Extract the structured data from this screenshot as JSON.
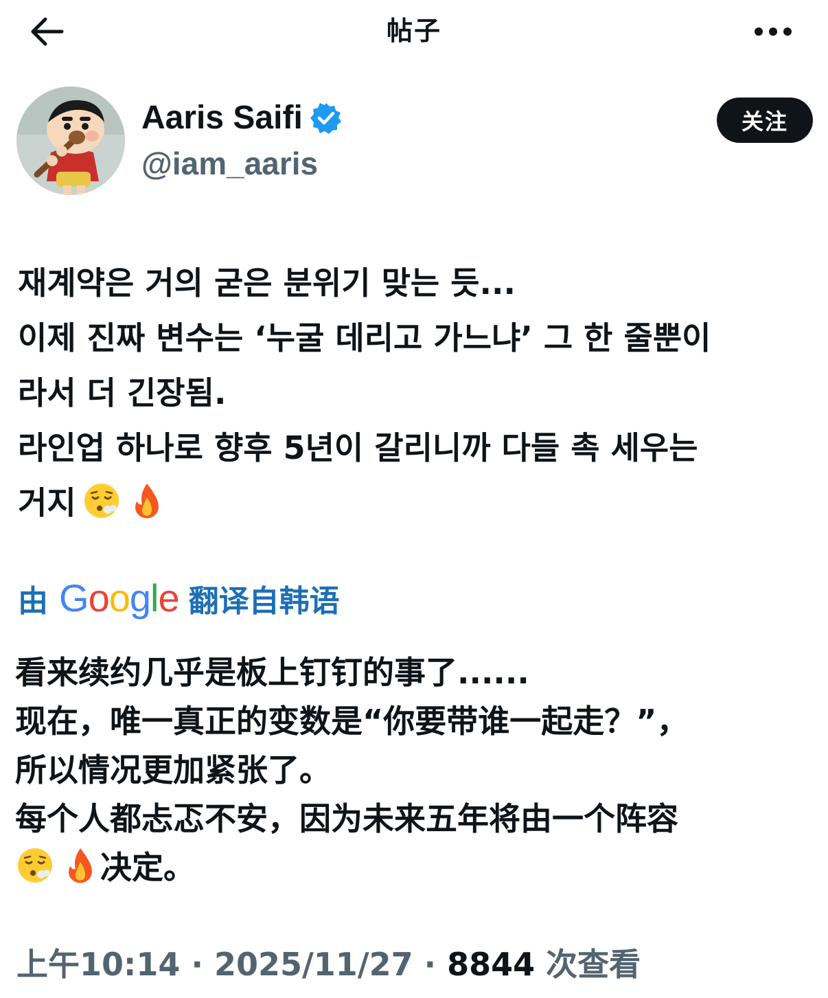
{
  "header": {
    "title": "帖子",
    "back_icon": "arrow-left-icon",
    "more_icon": "more-horizontal-icon"
  },
  "author": {
    "display_name": "Aaris Saifi",
    "handle": "@iam_aaris",
    "verified": true,
    "verified_color": "#1d9bf0",
    "follow_label": "关注"
  },
  "post": {
    "original_lines": [
      "재계약은 거의 굳은 분위기 맞는 듯...",
      "이제 진짜 변수는 ‘누굴 데리고 가느냐’ 그 한 줄뿐이",
      "라서 더 긴장됨.",
      "라인업 하나로 향후 5년이 갈리니까 다들 촉 세우는",
      "거지"
    ],
    "original_emojis": [
      "face-exhaling-emoji",
      "fire-emoji"
    ],
    "translation_prefix": "由",
    "translation_provider": "Google",
    "translation_suffix": "翻译自韩语",
    "translated_lines": [
      "看来续约几乎是板上钉钉的事了......",
      "现在，唯一真正的变数是“你要带谁一起走？”，",
      "所以情况更加紧张了。",
      "每个人都忐忑不安，因为未来五年将由一个阵容"
    ],
    "translated_last_line_text": "决定。",
    "translated_emojis": [
      "face-exhaling-emoji",
      "fire-emoji"
    ]
  },
  "meta": {
    "time": "上午10:14",
    "separator": "·",
    "date": "2025/11/27",
    "views_count": "8844",
    "views_label": "次查看"
  },
  "colors": {
    "text_primary": "#0f1419",
    "text_secondary": "#536471",
    "translate_link": "#1d6fb5",
    "follow_bg": "#0f1419"
  }
}
